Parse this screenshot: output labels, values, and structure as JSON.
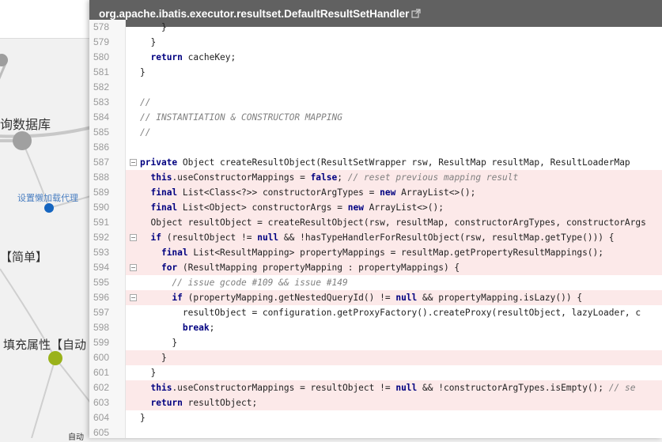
{
  "mindmap": {
    "labels": [
      "询数据库",
      "设置懒加载代理",
      "【简单】",
      "填充属性【自动",
      "自动"
    ]
  },
  "viewer": {
    "title": "org.apache.ibatis.executor.resultset.DefaultResultSetHandler",
    "lines": [
      {
        "n": "578",
        "hl": false,
        "fold": false,
        "parts": [
          [
            "t",
            "    }"
          ]
        ]
      },
      {
        "n": "579",
        "hl": false,
        "fold": false,
        "parts": [
          [
            "t",
            "  }"
          ]
        ]
      },
      {
        "n": "580",
        "hl": false,
        "fold": false,
        "parts": [
          [
            "t",
            "  "
          ],
          [
            "k",
            "return"
          ],
          [
            "t",
            " cacheKey;"
          ]
        ]
      },
      {
        "n": "581",
        "hl": false,
        "fold": false,
        "parts": [
          [
            "t",
            "}"
          ]
        ]
      },
      {
        "n": "582",
        "hl": false,
        "fold": false,
        "parts": [
          [
            "t",
            ""
          ]
        ]
      },
      {
        "n": "583",
        "hl": false,
        "fold": false,
        "parts": [
          [
            "c",
            "//"
          ]
        ]
      },
      {
        "n": "584",
        "hl": false,
        "fold": false,
        "parts": [
          [
            "c",
            "// INSTANTIATION & CONSTRUCTOR MAPPING"
          ]
        ]
      },
      {
        "n": "585",
        "hl": false,
        "fold": false,
        "parts": [
          [
            "c",
            "//"
          ]
        ]
      },
      {
        "n": "586",
        "hl": false,
        "fold": false,
        "parts": [
          [
            "t",
            ""
          ]
        ]
      },
      {
        "n": "587",
        "hl": false,
        "fold": true,
        "parts": [
          [
            "k",
            "private"
          ],
          [
            "t",
            " Object createResultObject(ResultSetWrapper rsw, ResultMap resultMap, ResultLoaderMap"
          ]
        ]
      },
      {
        "n": "588",
        "hl": true,
        "fold": false,
        "parts": [
          [
            "t",
            "  "
          ],
          [
            "k",
            "this"
          ],
          [
            "t",
            ".useConstructorMappings = "
          ],
          [
            "k",
            "false"
          ],
          [
            "t",
            "; "
          ],
          [
            "c",
            "// reset previous mapping result"
          ]
        ]
      },
      {
        "n": "589",
        "hl": true,
        "fold": false,
        "parts": [
          [
            "t",
            "  "
          ],
          [
            "k",
            "final"
          ],
          [
            "t",
            " List<Class<?>> constructorArgTypes = "
          ],
          [
            "k",
            "new"
          ],
          [
            "t",
            " ArrayList<>();"
          ]
        ]
      },
      {
        "n": "590",
        "hl": true,
        "fold": false,
        "parts": [
          [
            "t",
            "  "
          ],
          [
            "k",
            "final"
          ],
          [
            "t",
            " List<Object> constructorArgs = "
          ],
          [
            "k",
            "new"
          ],
          [
            "t",
            " ArrayList<>();"
          ]
        ]
      },
      {
        "n": "591",
        "hl": true,
        "fold": false,
        "parts": [
          [
            "t",
            "  Object resultObject = createResultObject(rsw, resultMap, constructorArgTypes, constructorArgs"
          ]
        ]
      },
      {
        "n": "592",
        "hl": true,
        "fold": true,
        "parts": [
          [
            "t",
            "  "
          ],
          [
            "k",
            "if"
          ],
          [
            "t",
            " (resultObject != "
          ],
          [
            "k",
            "null"
          ],
          [
            "t",
            " && !hasTypeHandlerForResultObject(rsw, resultMap.getType())) {"
          ]
        ]
      },
      {
        "n": "593",
        "hl": true,
        "fold": false,
        "parts": [
          [
            "t",
            "    "
          ],
          [
            "k",
            "final"
          ],
          [
            "t",
            " List<ResultMapping> propertyMappings = resultMap.getPropertyResultMappings();"
          ]
        ]
      },
      {
        "n": "594",
        "hl": true,
        "fold": true,
        "parts": [
          [
            "t",
            "    "
          ],
          [
            "k",
            "for"
          ],
          [
            "t",
            " (ResultMapping propertyMapping : propertyMappings) {"
          ]
        ]
      },
      {
        "n": "595",
        "hl": false,
        "fold": false,
        "parts": [
          [
            "t",
            "      "
          ],
          [
            "c",
            "// issue gcode #109 && issue #149"
          ]
        ]
      },
      {
        "n": "596",
        "hl": true,
        "fold": true,
        "parts": [
          [
            "t",
            "      "
          ],
          [
            "k",
            "if"
          ],
          [
            "t",
            " (propertyMapping.getNestedQueryId() != "
          ],
          [
            "k",
            "null"
          ],
          [
            "t",
            " && propertyMapping.isLazy()) {"
          ]
        ]
      },
      {
        "n": "597",
        "hl": false,
        "fold": false,
        "parts": [
          [
            "t",
            "        resultObject = configuration.getProxyFactory().createProxy(resultObject, lazyLoader, c"
          ]
        ]
      },
      {
        "n": "598",
        "hl": false,
        "fold": false,
        "parts": [
          [
            "t",
            "        "
          ],
          [
            "k",
            "break"
          ],
          [
            "t",
            ";"
          ]
        ]
      },
      {
        "n": "599",
        "hl": false,
        "fold": false,
        "parts": [
          [
            "t",
            "      }"
          ]
        ]
      },
      {
        "n": "600",
        "hl": true,
        "fold": false,
        "parts": [
          [
            "t",
            "    }"
          ]
        ]
      },
      {
        "n": "601",
        "hl": false,
        "fold": false,
        "parts": [
          [
            "t",
            "  }"
          ]
        ]
      },
      {
        "n": "602",
        "hl": true,
        "fold": false,
        "parts": [
          [
            "t",
            "  "
          ],
          [
            "k",
            "this"
          ],
          [
            "t",
            ".useConstructorMappings = resultObject != "
          ],
          [
            "k",
            "null"
          ],
          [
            "t",
            " && !constructorArgTypes.isEmpty(); "
          ],
          [
            "c",
            "// se"
          ]
        ]
      },
      {
        "n": "603",
        "hl": true,
        "fold": false,
        "parts": [
          [
            "t",
            "  "
          ],
          [
            "k",
            "return"
          ],
          [
            "t",
            " resultObject;"
          ]
        ]
      },
      {
        "n": "604",
        "hl": false,
        "fold": false,
        "parts": [
          [
            "t",
            "}"
          ]
        ]
      },
      {
        "n": "605",
        "hl": false,
        "fold": false,
        "parts": [
          [
            "t",
            ""
          ]
        ]
      }
    ]
  }
}
